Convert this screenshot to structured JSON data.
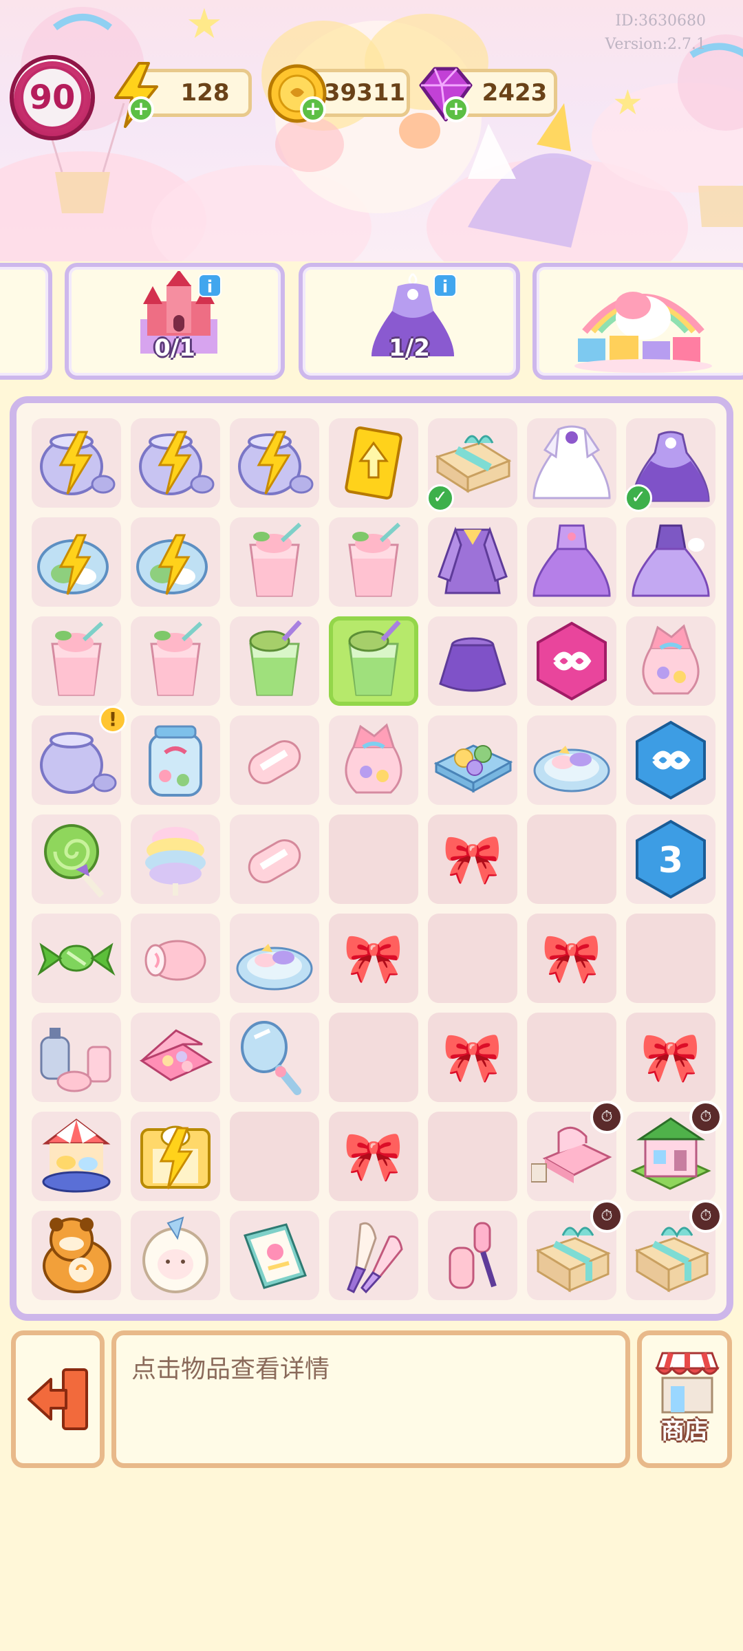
{
  "header": {
    "player_id": "ID:3630680",
    "version": "Version:2.7.1",
    "level": "90",
    "energy": "128",
    "coins": "39311",
    "gems": "2423"
  },
  "quests": [
    {
      "name": "castle-quest",
      "progress": "0/1"
    },
    {
      "name": "dress-quest",
      "progress": "1/2"
    },
    {
      "name": "unicorn-gift-quest",
      "progress": ""
    }
  ],
  "board": {
    "rows": [
      [
        "jar-bolt",
        "jar-bolt",
        "jar-bolt",
        "arrow-card",
        "gift-box-check",
        "white-dress",
        "purple-dress-check"
      ],
      [
        "blue-jar-bolt",
        "blue-jar-bolt",
        "pink-smoothie",
        "pink-smoothie",
        "purple-jacket",
        "purple-dress",
        "lilac-dress"
      ],
      [
        "pink-smoothie",
        "pink-smoothie",
        "green-smoothie",
        "green-smoothie-selected",
        "purple-skirt",
        "pink-infinity",
        "candy-bag"
      ],
      [
        "jar-alert",
        "candy-jar",
        "marshmallow",
        "candy-bag",
        "candy-tray",
        "candy-plate",
        "blue-infinity"
      ],
      [
        "lollipop",
        "cotton-candy",
        "marshmallow",
        "empty",
        "bow",
        "empty",
        "blue-3"
      ],
      [
        "wrapped-candy",
        "roll-cake",
        "candy-plate",
        "bow",
        "empty",
        "bow",
        "empty"
      ],
      [
        "cosmetics-set",
        "makeup-palette",
        "hand-mirror",
        "empty",
        "bow",
        "empty",
        "bow"
      ],
      [
        "carousel",
        "carousel-bolt",
        "empty",
        "bow",
        "empty",
        "bedroom-timer",
        "house-timer"
      ],
      [
        "raccoon-plush",
        "sheep-plush",
        "sketchbook",
        "brush-set",
        "hair-roller",
        "gift-timer",
        "gift-timer"
      ]
    ]
  },
  "bottom": {
    "description": "点击物品查看详情",
    "shop_label": "商店"
  }
}
